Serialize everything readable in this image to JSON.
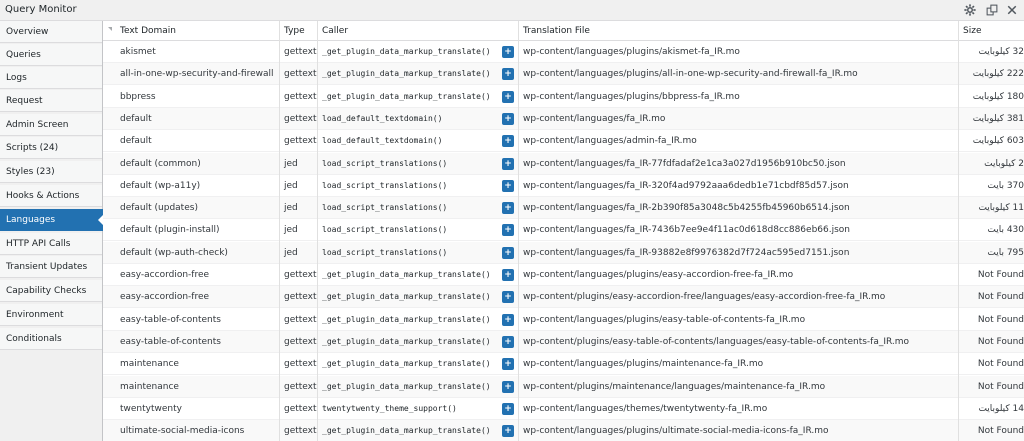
{
  "window": {
    "title": "Query Monitor"
  },
  "nav": [
    {
      "label": "Overview"
    },
    {
      "label": "Queries"
    },
    {
      "label": "Logs"
    },
    {
      "label": "Request"
    },
    {
      "label": "Admin Screen"
    },
    {
      "label": "Scripts (24)"
    },
    {
      "label": "Styles (23)"
    },
    {
      "label": "Hooks & Actions"
    },
    {
      "label": "Languages",
      "active": true
    },
    {
      "label": "HTTP API Calls"
    },
    {
      "label": "Transient Updates"
    },
    {
      "label": "Capability Checks"
    },
    {
      "label": "Environment"
    },
    {
      "label": "Conditionals"
    }
  ],
  "table": {
    "headers": {
      "domain": "Text Domain",
      "type": "Type",
      "caller": "Caller",
      "file": "Translation File",
      "size": "Size"
    },
    "expand_label": "+",
    "rows": [
      {
        "domain": "akismet",
        "type": "gettext",
        "caller": "_get_plugin_data_markup_translate()",
        "file": "wp-content/languages/plugins/akismet-fa_IR.mo",
        "size": "32 کیلوبایت"
      },
      {
        "domain": "all-in-one-wp-security-and-firewall",
        "type": "gettext",
        "caller": "_get_plugin_data_markup_translate()",
        "file": "wp-content/languages/plugins/all-in-one-wp-security-and-firewall-fa_IR.mo",
        "size": "222 کیلوبایت"
      },
      {
        "domain": "bbpress",
        "type": "gettext",
        "caller": "_get_plugin_data_markup_translate()",
        "file": "wp-content/languages/plugins/bbpress-fa_IR.mo",
        "size": "180 کیلوبایت"
      },
      {
        "domain": "default",
        "type": "gettext",
        "caller": "load_default_textdomain()",
        "file": "wp-content/languages/fa_IR.mo",
        "size": "381 کیلوبایت"
      },
      {
        "domain": "default",
        "type": "gettext",
        "caller": "load_default_textdomain()",
        "file": "wp-content/languages/admin-fa_IR.mo",
        "size": "603 کیلوبایت"
      },
      {
        "domain": "default (common)",
        "type": "jed",
        "caller": "load_script_translations()",
        "file": "wp-content/languages/fa_IR-77fdfadaf2e1ca3a027d1956b910bc50.json",
        "size": "2 کیلوبایت"
      },
      {
        "domain": "default (wp-a11y)",
        "type": "jed",
        "caller": "load_script_translations()",
        "file": "wp-content/languages/fa_IR-320f4ad9792aaa6dedb1e71cbdf85d57.json",
        "size": "370 بایت"
      },
      {
        "domain": "default (updates)",
        "type": "jed",
        "caller": "load_script_translations()",
        "file": "wp-content/languages/fa_IR-2b390f85a3048c5b4255fb45960b6514.json",
        "size": "11 کیلوبایت"
      },
      {
        "domain": "default (plugin-install)",
        "type": "jed",
        "caller": "load_script_translations()",
        "file": "wp-content/languages/fa_IR-7436b7ee9e4f11ac0d618d8cc886eb66.json",
        "size": "430 بایت"
      },
      {
        "domain": "default (wp-auth-check)",
        "type": "jed",
        "caller": "load_script_translations()",
        "file": "wp-content/languages/fa_IR-93882e8f9976382d7f724ac595ed7151.json",
        "size": "795 بایت"
      },
      {
        "domain": "easy-accordion-free",
        "type": "gettext",
        "caller": "_get_plugin_data_markup_translate()",
        "file": "wp-content/languages/plugins/easy-accordion-free-fa_IR.mo",
        "size": "Not Found"
      },
      {
        "domain": "easy-accordion-free",
        "type": "gettext",
        "caller": "_get_plugin_data_markup_translate()",
        "file": "wp-content/plugins/easy-accordion-free/languages/easy-accordion-free-fa_IR.mo",
        "size": "Not Found"
      },
      {
        "domain": "easy-table-of-contents",
        "type": "gettext",
        "caller": "_get_plugin_data_markup_translate()",
        "file": "wp-content/languages/plugins/easy-table-of-contents-fa_IR.mo",
        "size": "Not Found"
      },
      {
        "domain": "easy-table-of-contents",
        "type": "gettext",
        "caller": "_get_plugin_data_markup_translate()",
        "file": "wp-content/plugins/easy-table-of-contents/languages/easy-table-of-contents-fa_IR.mo",
        "size": "Not Found"
      },
      {
        "domain": "maintenance",
        "type": "gettext",
        "caller": "_get_plugin_data_markup_translate()",
        "file": "wp-content/languages/plugins/maintenance-fa_IR.mo",
        "size": "Not Found"
      },
      {
        "domain": "maintenance",
        "type": "gettext",
        "caller": "_get_plugin_data_markup_translate()",
        "file": "wp-content/plugins/maintenance/languages/maintenance-fa_IR.mo",
        "size": "Not Found"
      },
      {
        "domain": "twentytwenty",
        "type": "gettext",
        "caller": "twentytwenty_theme_support()",
        "file": "wp-content/languages/themes/twentytwenty-fa_IR.mo",
        "size": "14 کیلوبایت"
      },
      {
        "domain": "ultimate-social-media-icons",
        "type": "gettext",
        "caller": "_get_plugin_data_markup_translate()",
        "file": "wp-content/languages/plugins/ultimate-social-media-icons-fa_IR.mo",
        "size": "Not Found"
      }
    ]
  }
}
